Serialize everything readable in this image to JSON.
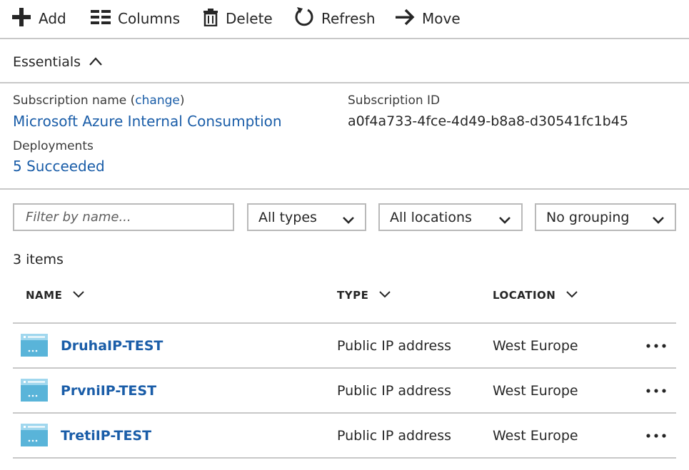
{
  "toolbar": {
    "add_label": "Add",
    "columns_label": "Columns",
    "delete_label": "Delete",
    "refresh_label": "Refresh",
    "move_label": "Move"
  },
  "essentials": {
    "title": "Essentials",
    "subscription_name_label": "Subscription name (",
    "change_link": "change",
    "subscription_name_label_close": ")",
    "subscription_name": "Microsoft Azure Internal Consumption",
    "subscription_id_label": "Subscription ID",
    "subscription_id": "a0f4a733-4fce-4d49-b8a8-d30541fc1b45",
    "deployments_label": "Deployments",
    "deployments_value": "5 Succeeded"
  },
  "filters": {
    "name_placeholder": "Filter by name...",
    "types_selected": "All types",
    "locations_selected": "All locations",
    "grouping_selected": "No grouping"
  },
  "items_count": "3 items",
  "table": {
    "headers": {
      "name": "NAME",
      "type": "TYPE",
      "location": "LOCATION"
    },
    "rows": [
      {
        "name": "DruhaIP-TEST",
        "type": "Public IP address",
        "location": "West Europe"
      },
      {
        "name": "PrvniIP-TEST",
        "type": "Public IP address",
        "location": "West Europe"
      },
      {
        "name": "TretiIP-TEST",
        "type": "Public IP address",
        "location": "West Europe"
      }
    ]
  },
  "colors": {
    "link": "#1a5da8",
    "border": "#c8c8c8",
    "icon_blue": "#59b4d9"
  },
  "icons": {
    "add": "plus-icon",
    "columns": "columns-icon",
    "delete": "trash-icon",
    "refresh": "refresh-icon",
    "move": "arrow-right-icon",
    "resource": "public-ip-address-icon",
    "more": "ellipsis-icon"
  }
}
